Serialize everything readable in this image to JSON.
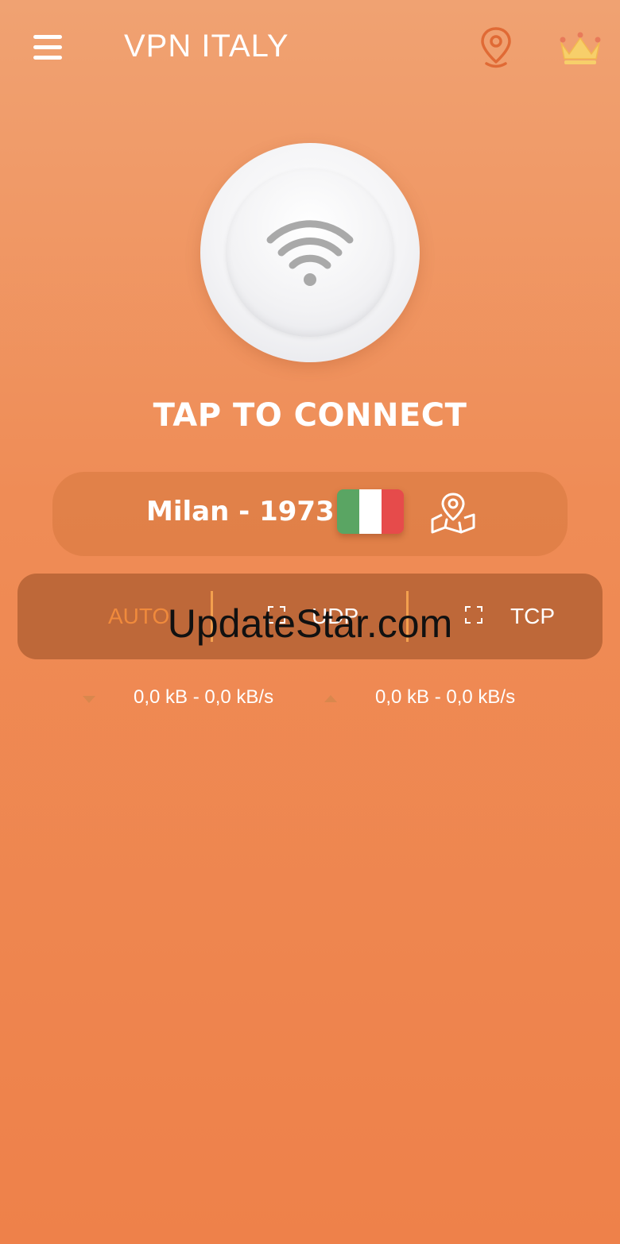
{
  "app": {
    "title": "VPN ITALY"
  },
  "header": {
    "menu_icon": "hamburger-menu-icon",
    "location_icon": "location-pin-icon",
    "premium_icon": "crown-icon"
  },
  "connect": {
    "icon": "wifi-icon",
    "label": "TAP TO CONNECT"
  },
  "server": {
    "name": "Milan - 1973",
    "flag_colors": [
      "#5aa563",
      "#ffffff",
      "#e64b4b"
    ],
    "map_icon": "map-pin-icon"
  },
  "protocols": {
    "options": [
      {
        "label": "AUTO",
        "selected": true
      },
      {
        "label": "UDP",
        "selected": false
      },
      {
        "label": "TCP",
        "selected": false
      }
    ]
  },
  "watermark": "UpdateStar.com",
  "traffic": {
    "download": "0,0 kB - 0,0 kB/s",
    "upload": "0,0 kB - 0,0 kB/s"
  },
  "colors": {
    "accent": "#ef8c56",
    "protocol_selected": "#f08a3c",
    "divider": "#f3a04e"
  }
}
